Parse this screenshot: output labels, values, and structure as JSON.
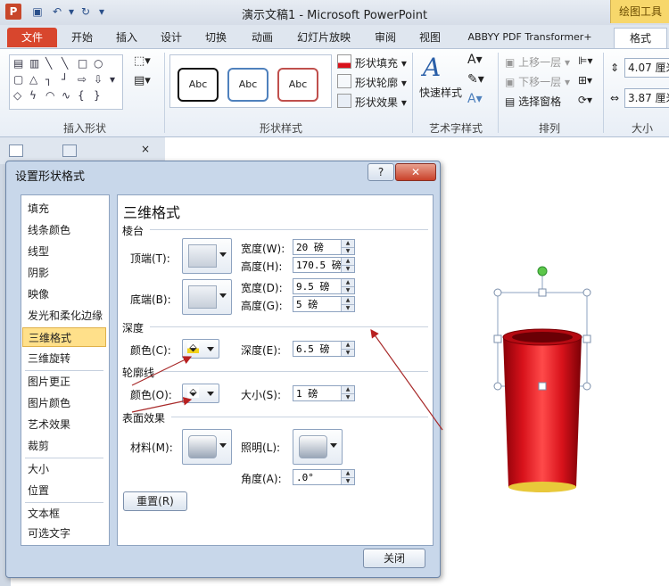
{
  "window": {
    "title": "演示文稿1 - Microsoft PowerPoint",
    "logo": "P",
    "contextual_tab": "绘图工具"
  },
  "ribbon": {
    "tabs": [
      "文件",
      "开始",
      "插入",
      "设计",
      "切换",
      "动画",
      "幻灯片放映",
      "审阅",
      "视图",
      "ABBYY PDF Transformer+",
      "格式"
    ],
    "groups": {
      "insert_shapes": "插入形状",
      "shape_styles": "形状样式",
      "wordart": "艺术字样式",
      "arrange": "排列",
      "size": "大小"
    },
    "style_samples": [
      "Abc",
      "Abc",
      "Abc"
    ],
    "shape_fill": "形状填充",
    "shape_outline": "形状轮廓",
    "shape_effects": "形状效果",
    "quick_styles": "快速样式",
    "bring_forward": "上移一层",
    "send_backward": "下移一层",
    "selection_pane": "选择窗格",
    "height": "4.07 厘米",
    "width": "3.87 厘米"
  },
  "dialog": {
    "title": "设置形状格式",
    "help": "?",
    "nav": [
      "填充",
      "线条颜色",
      "线型",
      "阴影",
      "映像",
      "发光和柔化边缘",
      "三维格式",
      "三维旋转",
      "图片更正",
      "图片颜色",
      "艺术效果",
      "裁剪",
      "大小",
      "位置",
      "文本框",
      "可选文字"
    ],
    "selected_nav": "三维格式",
    "panel_title": "三维格式",
    "bevel": {
      "section": "棱台",
      "top_label": "顶端(T):",
      "bottom_label": "底端(B):",
      "top_width_label": "宽度(W):",
      "top_width": "20 磅",
      "top_height_label": "高度(H):",
      "top_height": "170.5 磅",
      "bottom_width_label": "宽度(D):",
      "bottom_width": "9.5 磅",
      "bottom_height_label": "高度(G):",
      "bottom_height": "5 磅"
    },
    "depth": {
      "section": "深度",
      "color_label": "颜色(C):",
      "depth_label": "深度(E):",
      "depth": "6.5 磅",
      "color": "#f2d21a"
    },
    "contour": {
      "section": "轮廓线",
      "color_label": "颜色(O):",
      "size_label": "大小(S):",
      "size": "1 磅"
    },
    "surface": {
      "section": "表面效果",
      "material_label": "材料(M):",
      "lighting_label": "照明(L):",
      "angle_label": "角度(A):",
      "angle": ".0°"
    },
    "reset": "重置(R)",
    "close": "关闭"
  },
  "colors": {
    "accent_file": "#d8462d",
    "cup_red": "#d8121b",
    "cup_gold": "#e8c93a",
    "handle_green": "#5cc74a"
  }
}
